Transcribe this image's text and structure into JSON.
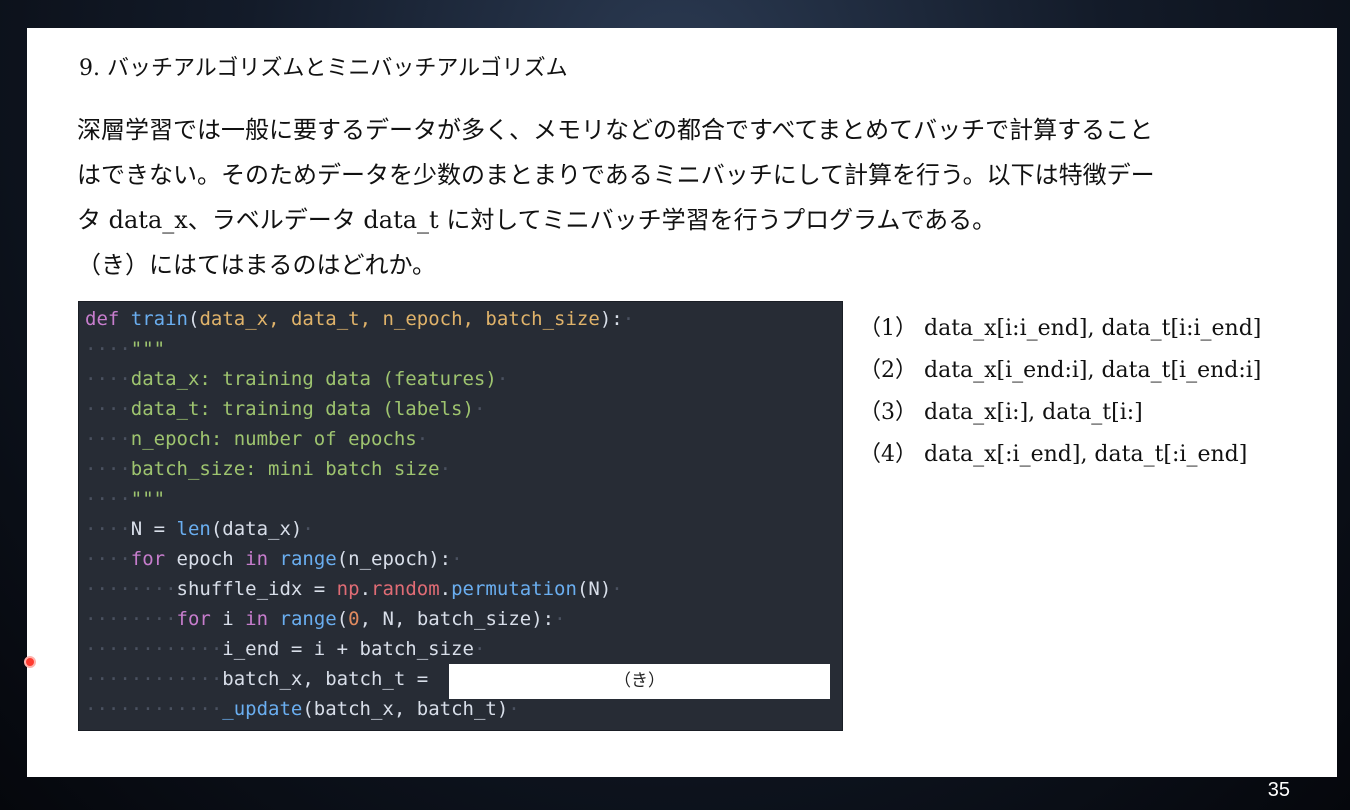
{
  "slide": {
    "heading": "9. バッチアルゴリズムとミニバッチアルゴリズム",
    "paragraph_lines": [
      "深層学習では一般に要するデータが多く、メモリなどの都合ですべてまとめてバッチで計算すること",
      "はできない。そのためデータを少数のまとまりであるミニバッチにして計算を行う。以下は特徴デー",
      "タ data_x、ラベルデータ data_t に対してミニバッチ学習を行うプログラムである。",
      "（き）にはてはまるのはどれか。"
    ],
    "blank_label": "（き）",
    "options": [
      "（1） data_x[i:i_end], data_t[i:i_end]",
      "（2） data_x[i_end:i], data_t[i_end:i]",
      "（3） data_x[i:], data_t[i:]",
      "（4） data_x[:i_end], data_t[:i_end]"
    ],
    "page_number": "35"
  },
  "code": {
    "l1": {
      "kw": "def",
      "fn": "train",
      "open": "(",
      "params": "data_x, data_t, n_epoch, batch_size",
      "close": "):"
    },
    "l2": "\"\"\"",
    "l3": "data_x: training data (features)",
    "l4": "data_t: training data (labels)",
    "l5": "n_epoch: number of epochs",
    "l6": "batch_size: mini batch size",
    "l7": "\"\"\"",
    "l8": {
      "a": "N = ",
      "fn": "len",
      "b": "(data_x)"
    },
    "l9": {
      "kw1": "for",
      "a": " epoch ",
      "kw2": "in",
      "sp": " ",
      "fn": "range",
      "b": "(n_epoch):"
    },
    "l10": {
      "a": "shuffle_idx = ",
      "mod1": "np",
      "dot1": ".",
      "mod2": "random",
      "dot2": ".",
      "fn": "permutation",
      "b": "(N)"
    },
    "l11": {
      "kw1": "for",
      "a": " i ",
      "kw2": "in",
      "sp": " ",
      "fn": "range",
      "b": "(",
      "num": "0",
      "c": ", N, batch_size):"
    },
    "l12": "i_end = i + batch_size",
    "l13": "batch_x, batch_t = ",
    "l14": {
      "fn": "_update",
      "b": "(batch_x, batch_t)"
    }
  }
}
